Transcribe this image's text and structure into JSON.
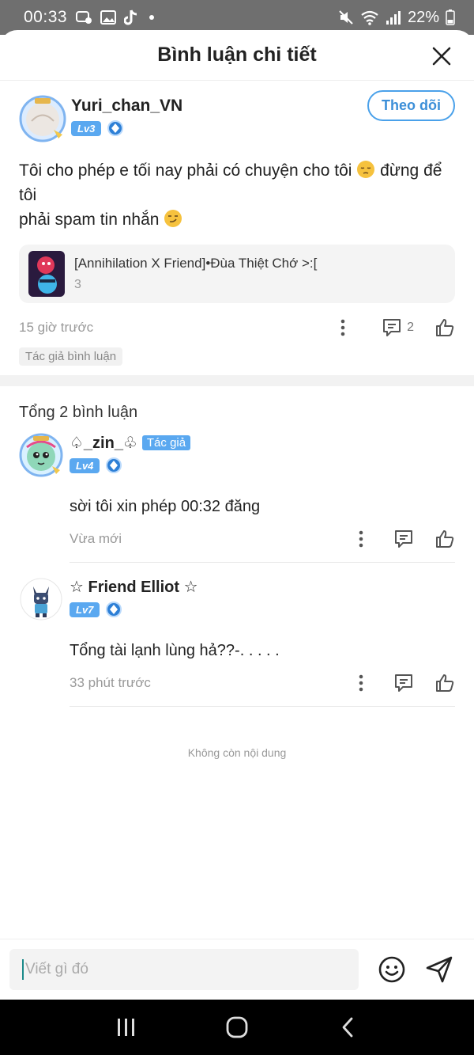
{
  "status_bar": {
    "time": "00:33",
    "battery": "22%"
  },
  "header": {
    "title": "Bình luận chi tiết"
  },
  "main_comment": {
    "username": "Yuri_chan_VN",
    "level": "Lv3",
    "follow_label": "Theo dõi",
    "text_line1": "Tôi cho phép e tối nay phải có chuyện cho tôi",
    "text_line1_end": "đừng để tôi",
    "text_line2": "phải spam tin nhắn",
    "emoji_1": "pensive-face",
    "emoji_2": "smirking-face",
    "attachment": {
      "title": "[Annihilation X Friend]•Đùa Thiệt Chớ >:[",
      "count": "3"
    },
    "time": "15 giờ trước",
    "reply_count": "2",
    "tag": "Tác giả bình luận"
  },
  "replies_header": "Tổng 2 bình luận",
  "replies": [
    {
      "username": "♤_zin_♧",
      "author_tag": "Tác giả",
      "level": "Lv4",
      "text": "sời tôi xin phép 00:32 đăng",
      "time": "Vừa mới"
    },
    {
      "username": "☆ Friend Elliot ☆",
      "level": "Lv7",
      "text": "Tổng tài lạnh lùng hả??-. . . . .",
      "time": "33 phút trước"
    }
  ],
  "end_text": "Không còn nội dung",
  "input": {
    "placeholder": "Viết gì đó"
  },
  "colors": {
    "accent": "#4aa1ea",
    "level_badge": "#5aa8f0",
    "status_bar": "#6f6f6f"
  }
}
